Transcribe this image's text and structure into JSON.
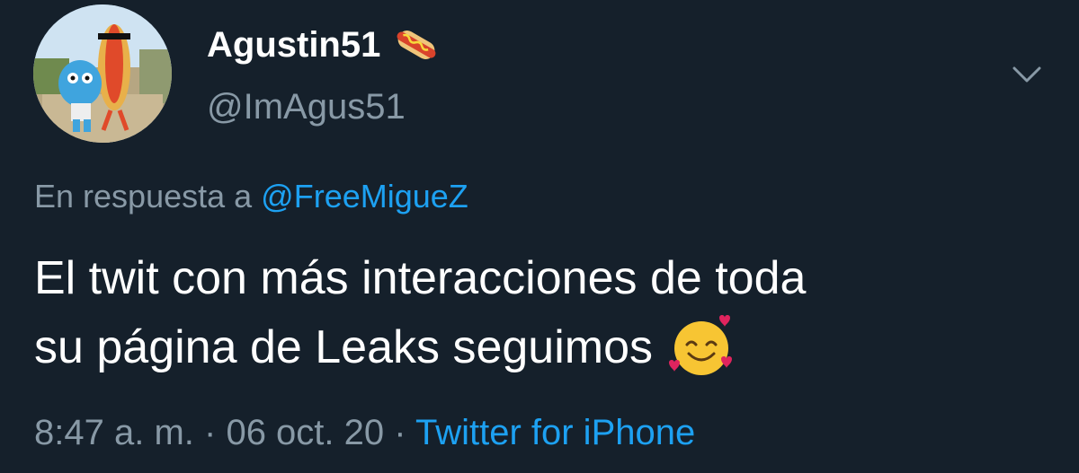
{
  "tweet": {
    "author": {
      "display_name": "Agustin51",
      "name_emoji": "hotdog-icon",
      "handle": "@ImAgus51",
      "avatar": "cartoon-avatar"
    },
    "menu_icon": "chevron-down-icon",
    "reply_prefix": "En respuesta a",
    "reply_mention": "@FreeMigueZ",
    "text_line1": "El twit con más interacciones de toda",
    "text_line2": "su página de Leaks seguimos",
    "text_emoji": "smiling-face-with-hearts-icon",
    "time": "8:47 a. m.",
    "separator": "·",
    "date": "06 oct. 20",
    "source": "Twitter for iPhone"
  },
  "colors": {
    "background": "#15202b",
    "primary_text": "#ffffff",
    "secondary_text": "#8899a6",
    "link": "#1da1f2"
  }
}
